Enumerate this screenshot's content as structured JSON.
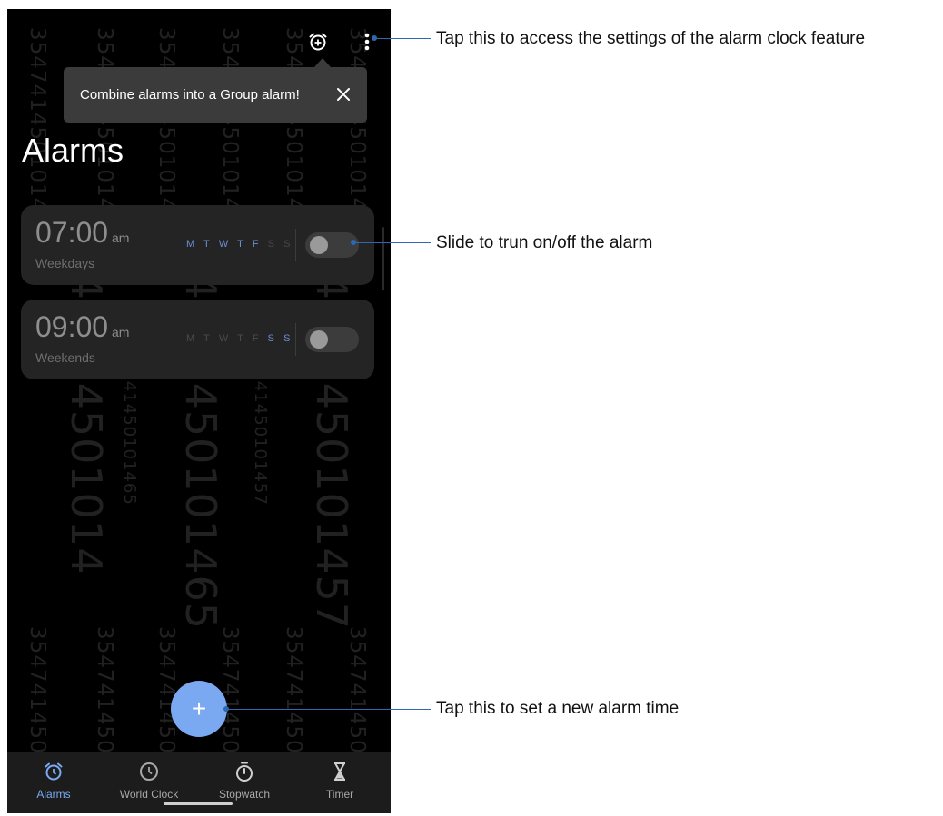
{
  "tooltip": {
    "text": "Combine alarms into a Group alarm!"
  },
  "page_title": "Alarms",
  "alarms": [
    {
      "time": "07:00",
      "ampm": "am",
      "label": "Weekdays",
      "days": [
        "M",
        "T",
        "W",
        "T",
        "F",
        "S",
        "S"
      ],
      "enabled": false
    },
    {
      "time": "09:00",
      "ampm": "am",
      "label": "Weekends",
      "days": [
        "M",
        "T",
        "W",
        "T",
        "F",
        "S",
        "S"
      ],
      "enabled": false
    }
  ],
  "fab": {
    "label": "+"
  },
  "nav": [
    {
      "label": "Alarms",
      "icon": "alarm-clock-icon",
      "active": true
    },
    {
      "label": "World Clock",
      "icon": "clock-icon",
      "active": false
    },
    {
      "label": "Stopwatch",
      "icon": "stopwatch-icon",
      "active": false
    },
    {
      "label": "Timer",
      "icon": "hourglass-icon",
      "active": false
    }
  ],
  "watermark": {
    "small": "354741450101465",
    "big1": "3547414501014",
    "big2": "354741450101465",
    "big3": "354741450101457",
    "mid1": "354741450101465",
    "mid2": "354741450101457"
  },
  "callouts": {
    "settings": "Tap this to access the settings of the alarm clock feature",
    "toggle": "Slide to trun on/off the alarm",
    "new_alarm": "Tap this to set a new alarm time"
  },
  "colors": {
    "accent": "#7aa9f1",
    "callout_line": "#2f67b1",
    "background": "#000000",
    "card": "#242424"
  }
}
